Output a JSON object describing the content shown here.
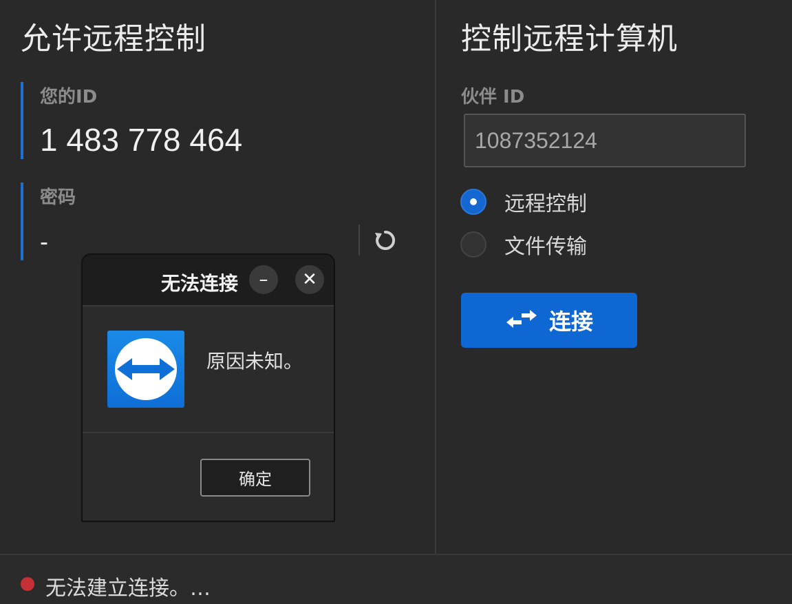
{
  "left": {
    "title": "允许远程控制",
    "id_label": "您的ID",
    "id_value": "1 483 778 464",
    "password_label": "密码",
    "password_value": "-",
    "refresh_icon": "refresh-icon"
  },
  "right": {
    "title": "控制远程计算机",
    "partner_label": "伙伴 ID",
    "partner_value": "1087352124",
    "options": [
      {
        "label": "远程控制",
        "selected": true
      },
      {
        "label": "文件传输",
        "selected": false
      }
    ],
    "connect_label": "连接",
    "connect_icon": "swap-arrows-icon"
  },
  "dialog": {
    "title": "无法连接",
    "minimize_glyph": "–",
    "close_glyph": "✕",
    "message": "原因未知。",
    "ok_label": "确定"
  },
  "status": {
    "text": "无法建立连接。…",
    "color": "#c62f35"
  },
  "colors": {
    "accent": "#0e67d2",
    "background": "#292929"
  }
}
